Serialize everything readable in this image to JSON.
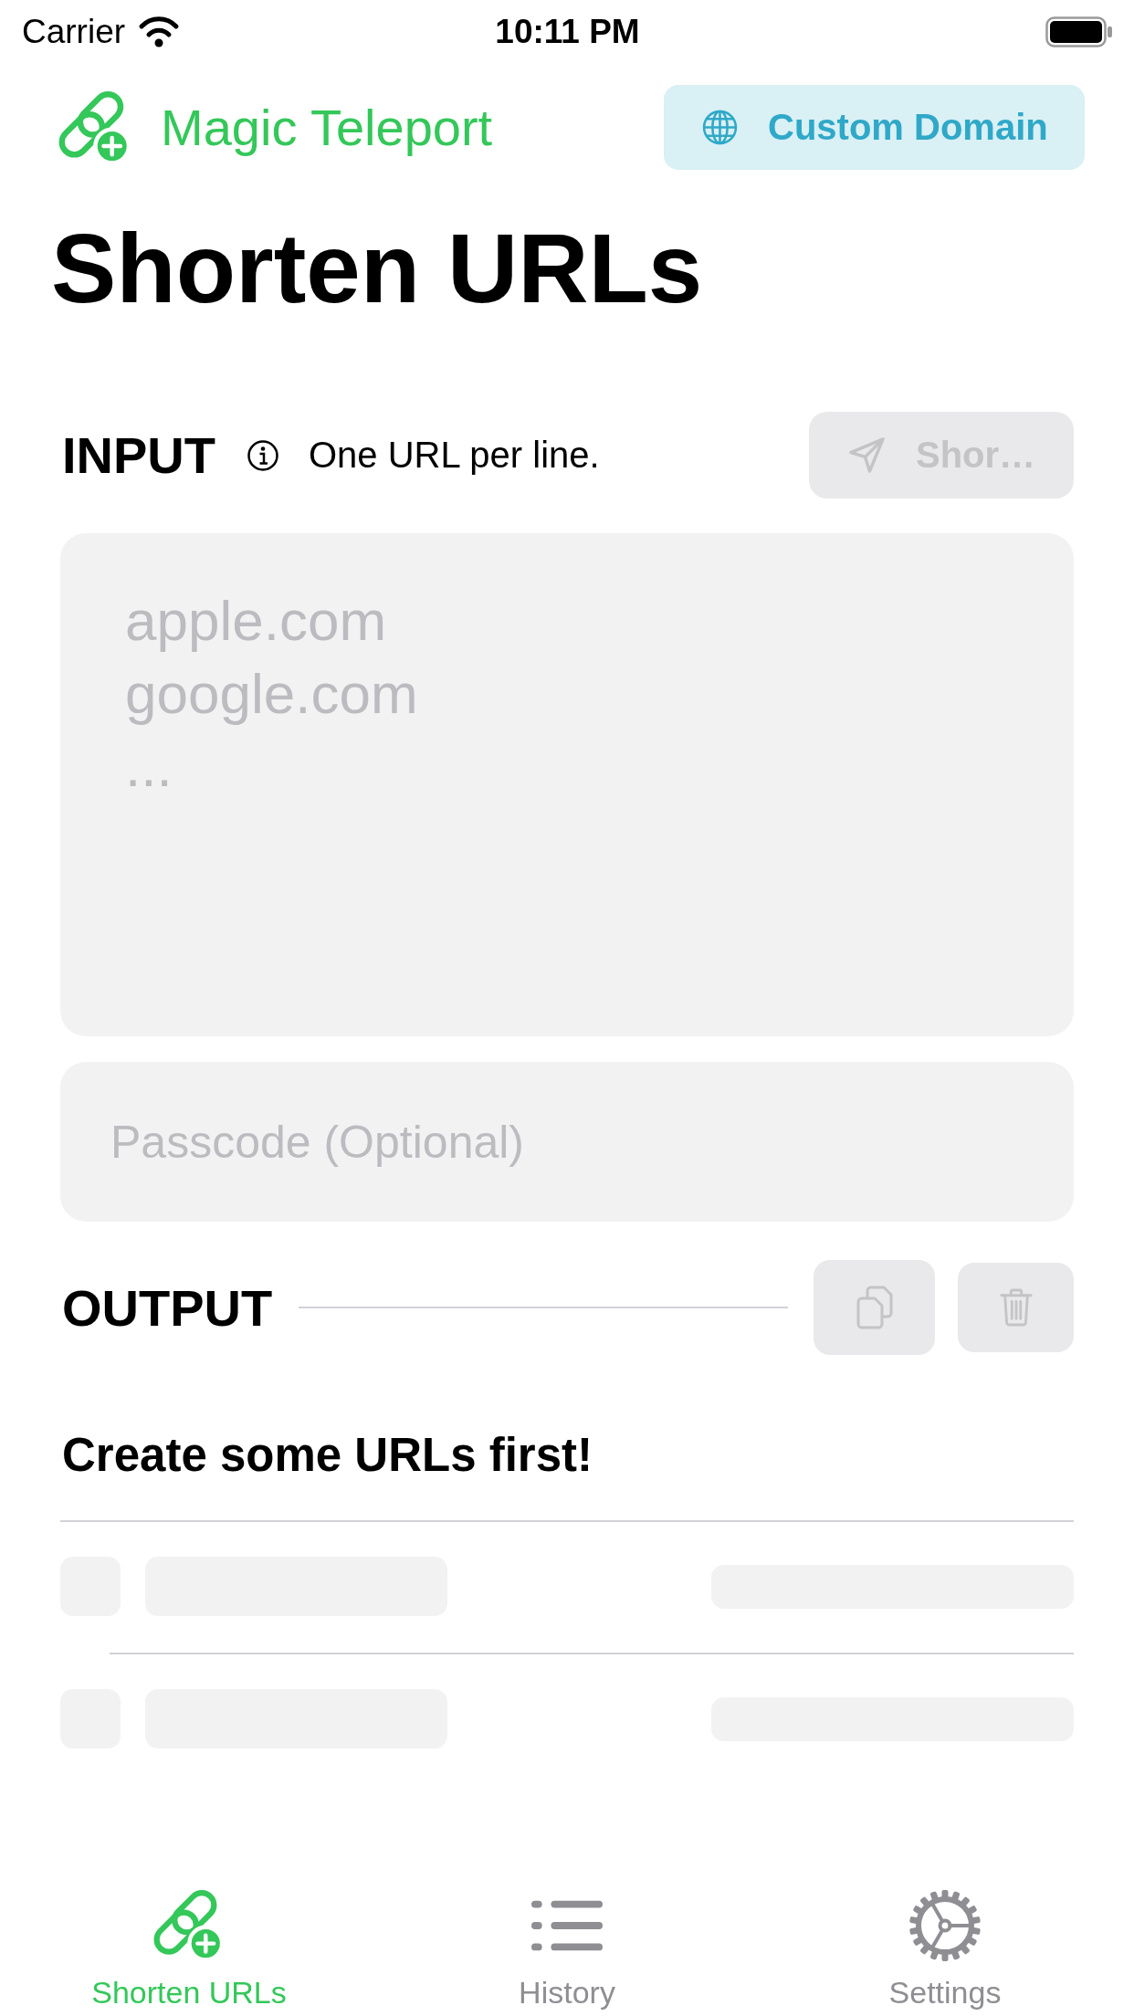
{
  "status_bar": {
    "carrier": "Carrier",
    "time": "10:11 PM"
  },
  "header": {
    "app_name": "Magic Teleport",
    "custom_domain_button": "Custom Domain"
  },
  "title": "Shorten URLs",
  "input": {
    "heading": "INPUT",
    "hint": "One URL per line.",
    "shorten_button": {
      "label": "Shor…",
      "disabled": true
    },
    "urls_field": {
      "placeholder": "apple.com\ngoogle.com\n..."
    },
    "passcode_field": {
      "placeholder": "Passcode (Optional)"
    }
  },
  "output": {
    "heading": "OUTPUT",
    "copy_button": {
      "disabled": true
    },
    "delete_button": {
      "disabled": true
    },
    "empty_message": "Create some URLs first!"
  },
  "tabs": [
    {
      "label": "Shorten URLs",
      "selected": true,
      "kind": "link"
    },
    {
      "label": "History",
      "selected": false,
      "kind": "list"
    },
    {
      "label": "Settings",
      "selected": false,
      "kind": "gear"
    }
  ]
}
